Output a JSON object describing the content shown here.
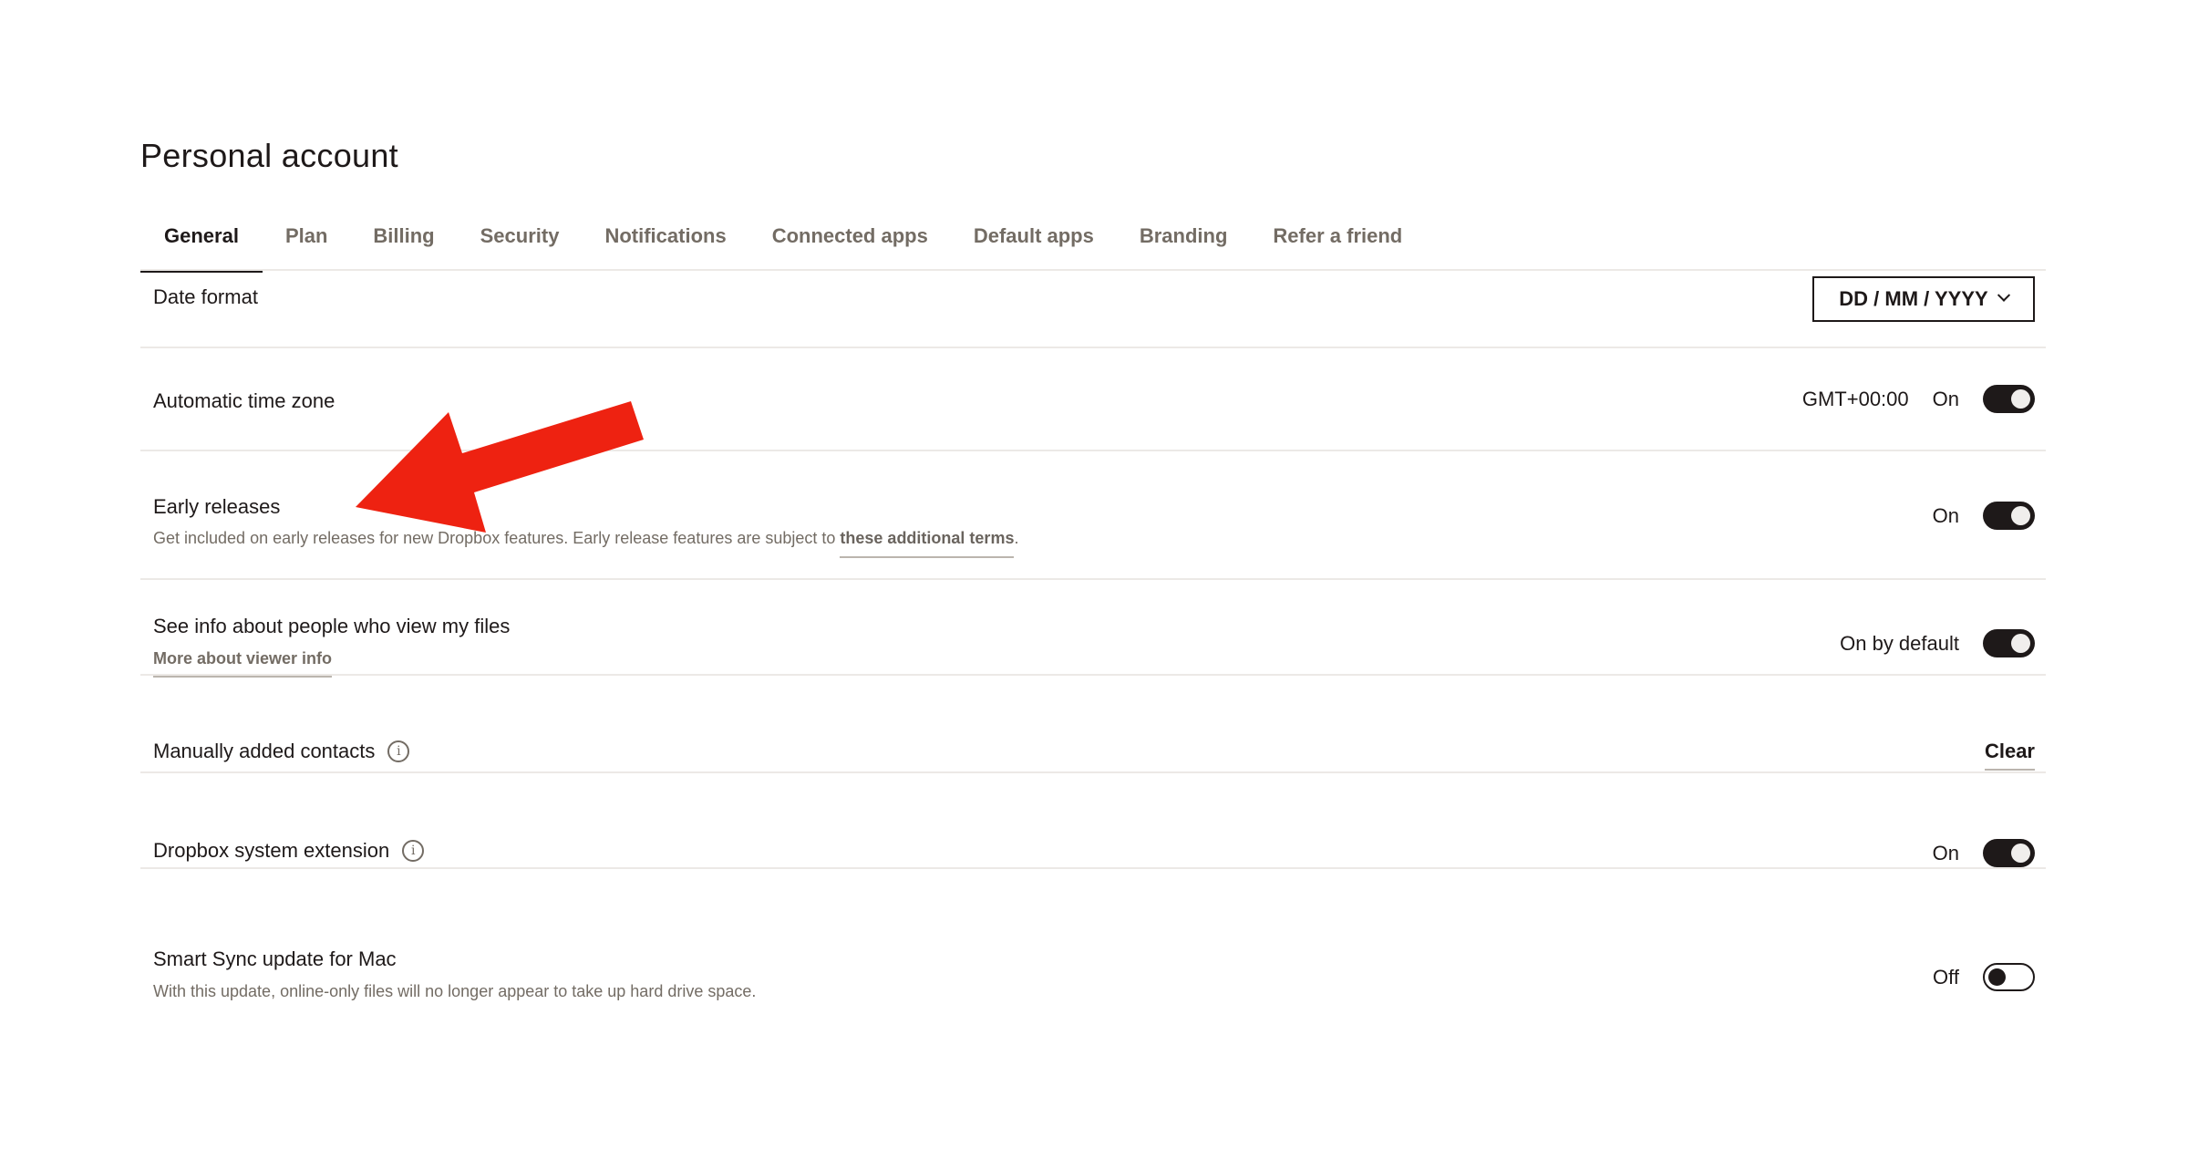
{
  "page": {
    "title": "Personal account"
  },
  "tabs": [
    {
      "label": "General",
      "active": true
    },
    {
      "label": "Plan",
      "active": false
    },
    {
      "label": "Billing",
      "active": false
    },
    {
      "label": "Security",
      "active": false
    },
    {
      "label": "Notifications",
      "active": false
    },
    {
      "label": "Connected apps",
      "active": false
    },
    {
      "label": "Default apps",
      "active": false
    },
    {
      "label": "Branding",
      "active": false
    },
    {
      "label": "Refer a friend",
      "active": false
    }
  ],
  "settings": {
    "date_format": {
      "title": "Date format",
      "value": "DD / MM / YYYY"
    },
    "time_zone": {
      "title": "Automatic time zone",
      "timezone": "GMT+00:00",
      "status": "On",
      "enabled": true
    },
    "early_releases": {
      "title": "Early releases",
      "description": "Get included on early releases for new Dropbox features. Early release features are subject to ",
      "link": "these additional terms",
      "after_link": ".",
      "status": "On",
      "enabled": true
    },
    "viewer_info": {
      "title": "See info about people who view my files",
      "link": "More about viewer info",
      "status": "On by default",
      "enabled": true
    },
    "contacts": {
      "title": "Manually added contacts",
      "info_icon": "i",
      "action": "Clear"
    },
    "system_extension": {
      "title": "Dropbox system extension",
      "info_icon": "i",
      "status": "On",
      "enabled": true
    },
    "smart_sync": {
      "title": "Smart Sync update for Mac",
      "description": "With this update, online-only files will no longer appear to take up hard drive space.",
      "status": "Off",
      "enabled": false
    }
  },
  "annotation": {
    "type": "arrow",
    "color": "#ee2211",
    "points_to": "Early releases"
  },
  "colors": {
    "text_primary": "#1e1919",
    "text_secondary": "#736c64",
    "divider": "#ece9e6",
    "toggle_on": "#1e1919"
  }
}
